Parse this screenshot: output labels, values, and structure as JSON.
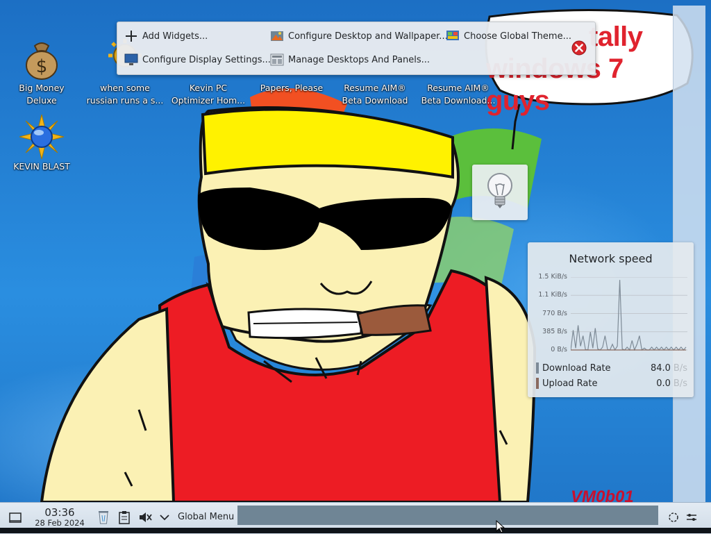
{
  "desktop": {
    "icons": [
      {
        "label": "Big Money\nDeluxe",
        "icon": "money-bag-icon"
      },
      {
        "label": "when some\nrussian runs a s...",
        "icon": "sun-gear-icon"
      },
      {
        "label": "Kevin PC\nOptimizer Hom...",
        "icon": "html-document-icon"
      },
      {
        "label": "Papers, Please",
        "icon": "papers-please-icon"
      },
      {
        "label": "Resume AIM®\nBeta Download",
        "icon": "aim-icon"
      },
      {
        "label": "Resume AIM®\nBeta Download...",
        "icon": "aim-icon"
      },
      {
        "label": "KEVIN BLAST",
        "icon": "kevin-blast-sun-icon"
      }
    ]
  },
  "toolbox": {
    "add_widgets": "Add Widgets...",
    "configure_desktop": "Configure Desktop and Wallpaper...",
    "choose_theme": "Choose Global Theme...",
    "configure_display": "Configure Display Settings...",
    "manage_desktops": "Manage Desktops And Panels..."
  },
  "wallpaper": {
    "bubble_line1": "tally",
    "bubble_line2": "windows 7 guys",
    "watermark": "VM0b01"
  },
  "network_widget": {
    "title": "Network speed",
    "download_label": "Download Rate",
    "download_value": "84.0",
    "download_unit": "B/s",
    "upload_label": "Upload Rate",
    "upload_value": "0.0",
    "upload_unit": "B/s",
    "download_color": "#7d8a96",
    "upload_color": "#8a6a5e"
  },
  "chart_data": {
    "type": "line",
    "title": "Network speed",
    "y_ticks": [
      "1.5 KiB/s",
      "1.1 KiB/s",
      "770 B/s",
      "385 B/s",
      "0 B/s"
    ],
    "ylim": [
      0,
      1540
    ],
    "series": [
      {
        "name": "Download Rate",
        "values": [
          0,
          420,
          40,
          520,
          80,
          300,
          10,
          0,
          380,
          40,
          460,
          20,
          0,
          60,
          300,
          10,
          0,
          120,
          0,
          80,
          1480,
          20,
          0,
          60,
          0,
          200,
          0,
          120,
          300,
          0,
          40,
          0,
          0,
          60,
          0,
          60,
          0,
          60,
          0,
          60,
          0,
          60,
          0,
          60,
          0,
          60,
          0,
          60
        ]
      },
      {
        "name": "Upload Rate",
        "values": [
          0,
          0,
          0,
          0,
          0,
          0,
          0,
          0,
          0,
          0,
          0,
          0,
          0,
          0,
          0,
          0,
          0,
          0,
          0,
          0,
          0,
          0,
          0,
          0,
          0,
          0,
          0,
          0,
          0,
          0,
          0,
          0,
          0,
          0,
          0,
          0,
          0,
          0,
          0,
          0,
          0,
          0,
          0,
          0,
          0,
          0,
          0,
          0
        ]
      }
    ]
  },
  "taskbar": {
    "time": "03:36",
    "date": "28 Feb 2024",
    "global_menu": "Global Menu"
  }
}
